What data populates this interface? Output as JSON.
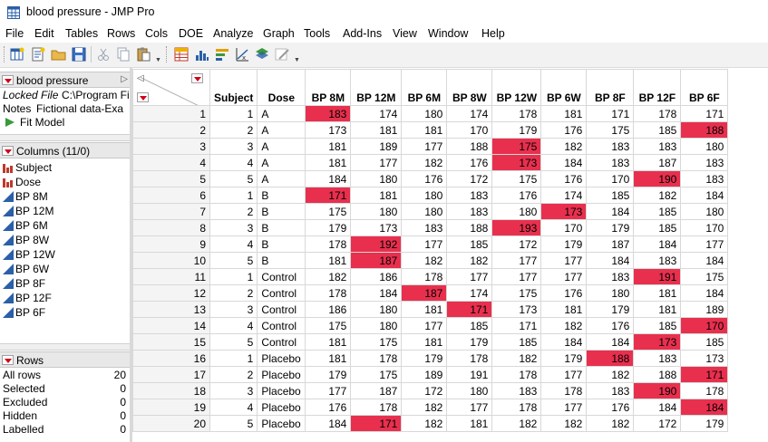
{
  "window": {
    "title": "blood pressure - JMP Pro"
  },
  "menu": [
    "File",
    "Edit",
    "Tables",
    "Rows",
    "Cols",
    "DOE",
    "Analyze",
    "Graph",
    "Tools",
    "Add-Ins",
    "View",
    "Window",
    "Help"
  ],
  "toolbar_icons": [
    "new-table-icon",
    "new-script-icon",
    "open-icon",
    "save-icon",
    "cut-icon",
    "copy-icon",
    "paste-icon",
    "data-table-icon",
    "distribution-icon",
    "fit-y-by-x-icon",
    "fit-model-icon",
    "graph-builder-icon",
    "annotate-icon"
  ],
  "table_panel": {
    "name": "blood pressure",
    "locked_label": "Locked File",
    "locked_value": "C:\\Program Fil",
    "notes_label": "Notes",
    "notes_value": "Fictional data-Exa",
    "script": "Fit Model"
  },
  "columns_panel": {
    "header": "Columns (11/0)",
    "items": [
      {
        "name": "Subject",
        "type": "nominal"
      },
      {
        "name": "Dose",
        "type": "nominal"
      },
      {
        "name": "BP 8M",
        "type": "continuous"
      },
      {
        "name": "BP 12M",
        "type": "continuous"
      },
      {
        "name": "BP 6M",
        "type": "continuous"
      },
      {
        "name": "BP 8W",
        "type": "continuous"
      },
      {
        "name": "BP 12W",
        "type": "continuous"
      },
      {
        "name": "BP 6W",
        "type": "continuous"
      },
      {
        "name": "BP 8F",
        "type": "continuous"
      },
      {
        "name": "BP 12F",
        "type": "continuous"
      },
      {
        "name": "BP 6F",
        "type": "continuous"
      }
    ]
  },
  "rows_panel": {
    "header": "Rows",
    "stats": [
      {
        "label": "All rows",
        "value": "20"
      },
      {
        "label": "Selected",
        "value": "0"
      },
      {
        "label": "Excluded",
        "value": "0"
      },
      {
        "label": "Hidden",
        "value": "0"
      },
      {
        "label": "Labelled",
        "value": "0"
      }
    ]
  },
  "grid": {
    "headers": [
      "Subject",
      "Dose",
      "BP 8M",
      "BP 12M",
      "BP 6M",
      "BP 8W",
      "BP 12W",
      "BP 6W",
      "BP 8F",
      "BP 12F",
      "BP 6F"
    ],
    "highlight_color": "#e8304e",
    "rows": [
      {
        "n": "1",
        "cells": [
          "1",
          "A",
          "183",
          "174",
          "180",
          "174",
          "178",
          "181",
          "171",
          "178",
          "171"
        ],
        "hl": [
          2
        ]
      },
      {
        "n": "2",
        "cells": [
          "2",
          "A",
          "173",
          "181",
          "181",
          "170",
          "179",
          "176",
          "175",
          "185",
          "188"
        ],
        "hl": [
          10
        ]
      },
      {
        "n": "3",
        "cells": [
          "3",
          "A",
          "181",
          "189",
          "177",
          "188",
          "175",
          "182",
          "183",
          "183",
          "180"
        ],
        "hl": [
          6
        ]
      },
      {
        "n": "4",
        "cells": [
          "4",
          "A",
          "181",
          "177",
          "182",
          "176",
          "173",
          "184",
          "183",
          "187",
          "183"
        ],
        "hl": [
          6
        ]
      },
      {
        "n": "5",
        "cells": [
          "5",
          "A",
          "184",
          "180",
          "176",
          "172",
          "175",
          "176",
          "170",
          "190",
          "183"
        ],
        "hl": [
          9
        ]
      },
      {
        "n": "6",
        "cells": [
          "1",
          "B",
          "171",
          "181",
          "180",
          "183",
          "176",
          "174",
          "185",
          "182",
          "184"
        ],
        "hl": [
          2
        ]
      },
      {
        "n": "7",
        "cells": [
          "2",
          "B",
          "175",
          "180",
          "180",
          "183",
          "180",
          "173",
          "184",
          "185",
          "180"
        ],
        "hl": [
          7
        ]
      },
      {
        "n": "8",
        "cells": [
          "3",
          "B",
          "179",
          "173",
          "183",
          "188",
          "193",
          "170",
          "179",
          "185",
          "170"
        ],
        "hl": [
          6
        ]
      },
      {
        "n": "9",
        "cells": [
          "4",
          "B",
          "178",
          "192",
          "177",
          "185",
          "172",
          "179",
          "187",
          "184",
          "177"
        ],
        "hl": [
          3
        ]
      },
      {
        "n": "10",
        "cells": [
          "5",
          "B",
          "181",
          "187",
          "182",
          "182",
          "177",
          "177",
          "184",
          "183",
          "184"
        ],
        "hl": [
          3
        ]
      },
      {
        "n": "11",
        "cells": [
          "1",
          "Control",
          "182",
          "186",
          "178",
          "177",
          "177",
          "177",
          "183",
          "191",
          "175"
        ],
        "hl": [
          9
        ]
      },
      {
        "n": "12",
        "cells": [
          "2",
          "Control",
          "178",
          "184",
          "187",
          "174",
          "175",
          "176",
          "180",
          "181",
          "184"
        ],
        "hl": [
          4
        ]
      },
      {
        "n": "13",
        "cells": [
          "3",
          "Control",
          "186",
          "180",
          "181",
          "171",
          "173",
          "181",
          "179",
          "181",
          "189"
        ],
        "hl": [
          5
        ]
      },
      {
        "n": "14",
        "cells": [
          "4",
          "Control",
          "175",
          "180",
          "177",
          "185",
          "171",
          "182",
          "176",
          "185",
          "170"
        ],
        "hl": [
          10
        ]
      },
      {
        "n": "15",
        "cells": [
          "5",
          "Control",
          "181",
          "175",
          "181",
          "179",
          "185",
          "184",
          "184",
          "173",
          "185"
        ],
        "hl": [
          9
        ]
      },
      {
        "n": "16",
        "cells": [
          "1",
          "Placebo",
          "181",
          "178",
          "179",
          "178",
          "182",
          "179",
          "188",
          "183",
          "173"
        ],
        "hl": [
          8
        ]
      },
      {
        "n": "17",
        "cells": [
          "2",
          "Placebo",
          "179",
          "175",
          "189",
          "191",
          "178",
          "177",
          "182",
          "188",
          "171"
        ],
        "hl": [
          10
        ]
      },
      {
        "n": "18",
        "cells": [
          "3",
          "Placebo",
          "177",
          "187",
          "172",
          "180",
          "183",
          "178",
          "183",
          "190",
          "178"
        ],
        "hl": [
          9
        ]
      },
      {
        "n": "19",
        "cells": [
          "4",
          "Placebo",
          "176",
          "178",
          "182",
          "177",
          "178",
          "177",
          "176",
          "184",
          "184"
        ],
        "hl": [
          10
        ]
      },
      {
        "n": "20",
        "cells": [
          "5",
          "Placebo",
          "184",
          "171",
          "182",
          "181",
          "182",
          "182",
          "182",
          "172",
          "179"
        ],
        "hl": [
          3
        ]
      }
    ]
  }
}
